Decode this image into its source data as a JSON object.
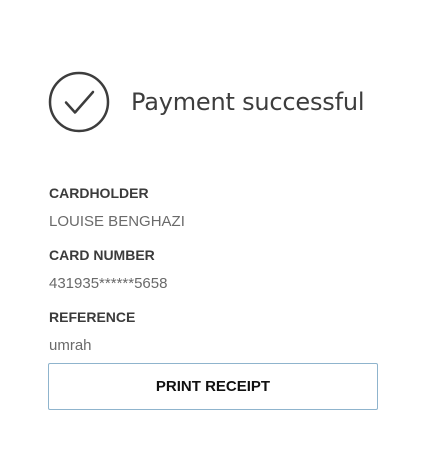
{
  "status": {
    "icon": "check-circle-icon",
    "title": "Payment successful"
  },
  "details": {
    "cardholder": {
      "label": "CARDHOLDER",
      "value": "LOUISE BENGHAZI"
    },
    "card_number": {
      "label": "CARD NUMBER",
      "value": "431935******5658"
    },
    "reference": {
      "label": "REFERENCE",
      "value": "umrah"
    }
  },
  "actions": {
    "print_label": "PRINT RECEIPT"
  },
  "colors": {
    "icon_stroke": "#3d3d3d",
    "button_border": "#8fb4cd"
  }
}
